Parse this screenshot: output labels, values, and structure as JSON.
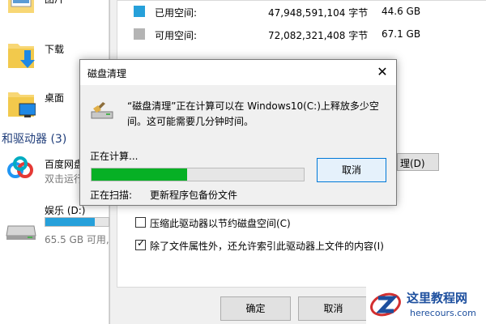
{
  "explorer": {
    "folders": [
      {
        "label": "图片"
      },
      {
        "label": "下载"
      },
      {
        "label": "桌面"
      }
    ],
    "section_title": "和驱动器 (3)",
    "drives": [
      {
        "name": "百度网盘",
        "sub": "双击运行"
      },
      {
        "name": "娱乐 (D:)",
        "sub": "65.5 GB 可用,",
        "used_fraction": 0.78
      }
    ]
  },
  "properties": {
    "used": {
      "label": "已用空间:",
      "bytes": "47,948,591,104 字节",
      "gb": "44.6 GB",
      "color": "#26a0da"
    },
    "free": {
      "label": "可用空间:",
      "bytes": "72,082,321,408 字节",
      "gb": "67.1 GB",
      "color": "#b4b4b4"
    },
    "cleanup_button": "理(D)",
    "compress_label": "压缩此驱动器以节约磁盘空间(C)",
    "compress_checked": false,
    "index_label": "除了文件属性外，还允许索引此驱动器上文件的内容(I)",
    "index_checked": true,
    "ok_button": "确定",
    "cancel_button": "取消"
  },
  "dialog": {
    "title": "磁盘清理",
    "close_glyph": "✕",
    "message": "“磁盘清理”正在计算可以在 Windows10(C:)上释放多少空间。这可能需要几分钟时间。",
    "status": "正在计算...",
    "progress": 0.45,
    "cancel_button": "取消",
    "scan_label": "正在扫描:",
    "scan_item": "更新程序包备份文件"
  },
  "watermark": {
    "title": "这里教程网",
    "site": "herecours.com"
  }
}
